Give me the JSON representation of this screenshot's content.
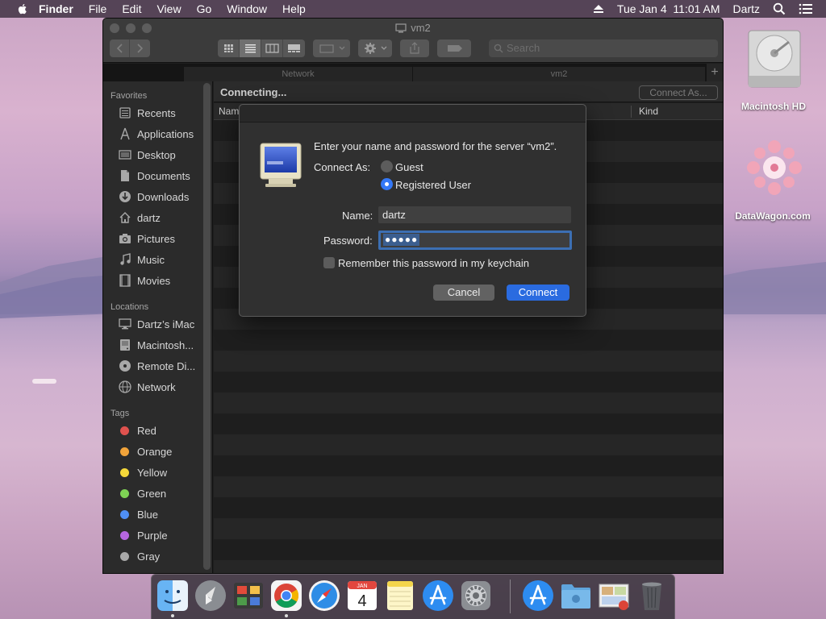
{
  "menubar": {
    "app_name": "Finder",
    "items": [
      "File",
      "Edit",
      "View",
      "Go",
      "Window",
      "Help"
    ],
    "datetime": "Tue Jan 4  11:01 AM",
    "user": "Dartz"
  },
  "window": {
    "title": "vm2",
    "search_placeholder": "Search",
    "tabs": [
      "Network",
      "vm2"
    ]
  },
  "sidebar": {
    "favorites_header": "Favorites",
    "favorites": [
      {
        "label": "Recents",
        "icon": "recents-icon"
      },
      {
        "label": "Applications",
        "icon": "applications-icon"
      },
      {
        "label": "Desktop",
        "icon": "desktop-icon"
      },
      {
        "label": "Documents",
        "icon": "documents-icon"
      },
      {
        "label": "Downloads",
        "icon": "downloads-icon"
      },
      {
        "label": "dartz",
        "icon": "home-icon"
      },
      {
        "label": "Pictures",
        "icon": "pictures-icon"
      },
      {
        "label": "Music",
        "icon": "music-icon"
      },
      {
        "label": "Movies",
        "icon": "movies-icon"
      }
    ],
    "locations_header": "Locations",
    "locations": [
      {
        "label": "Dartz’s iMac",
        "icon": "imac-icon"
      },
      {
        "label": "Macintosh...",
        "icon": "hard-drive-icon"
      },
      {
        "label": "Remote Di...",
        "icon": "remote-disc-icon"
      },
      {
        "label": "Network",
        "icon": "network-icon"
      }
    ],
    "tags_header": "Tags",
    "tags": [
      {
        "label": "Red",
        "color": "#e0524e"
      },
      {
        "label": "Orange",
        "color": "#f1a33a"
      },
      {
        "label": "Yellow",
        "color": "#f4d83a"
      },
      {
        "label": "Green",
        "color": "#7ed254"
      },
      {
        "label": "Blue",
        "color": "#4f8ff5"
      },
      {
        "label": "Purple",
        "color": "#b666e0"
      },
      {
        "label": "Gray",
        "color": "#a8a8a8"
      }
    ]
  },
  "main": {
    "status": "Connecting...",
    "connect_as_label": "Connect As...",
    "col_name": "Nam",
    "col_kind": "Kind"
  },
  "dialog": {
    "message": "Enter your name and password for the server “vm2”.",
    "connect_as_label": "Connect As:",
    "option_guest": "Guest",
    "option_registered": "Registered User",
    "name_label": "Name:",
    "name_value": "dartz",
    "password_label": "Password:",
    "password_value": "●●●●●",
    "remember_label": "Remember this password in my keychain",
    "cancel_label": "Cancel",
    "connect_label": "Connect"
  },
  "desktop": {
    "hd_label": "Macintosh HD",
    "datawagon_label": "DataWagon.com"
  },
  "dock": {
    "apps": [
      "finder-icon",
      "launchpad-icon",
      "photo-booth-icon",
      "chrome-icon",
      "safari-icon",
      "calendar-icon",
      "notes-icon",
      "app-store-icon",
      "system-preferences-icon",
      "downloads-stack-icon",
      "folder-icon",
      "preview-icon",
      "trash-icon"
    ],
    "calendar_month": "JAN",
    "calendar_day": "4"
  },
  "colors": {
    "accent": "#3478f6",
    "connect_button": "#2a6be0"
  }
}
